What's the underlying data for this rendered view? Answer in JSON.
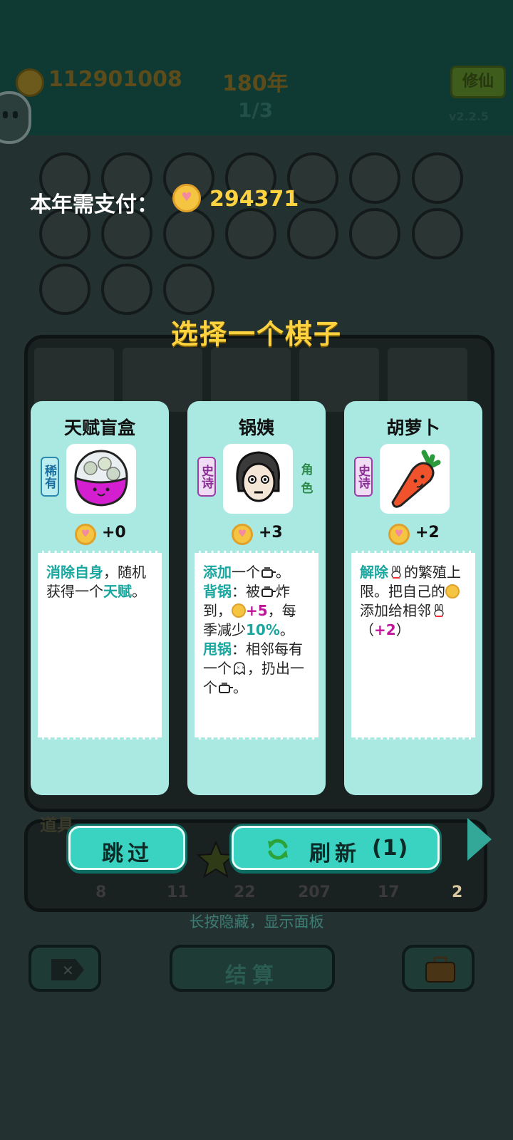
{
  "status_bar": {
    "gold": "112901008",
    "year": "180年",
    "round": "1/3",
    "version": "v2.2.5",
    "xiuxian_label": "修仙"
  },
  "overlay": {
    "pay_label": "本年需支付：",
    "pay_amount": "294371",
    "choose_title": "选择一个棋子"
  },
  "cards": [
    {
      "title": "天赋盲盒",
      "rarity": "稀有",
      "side_tag": "",
      "portrait_icon": "gacha-capsule-icon",
      "price": "+0",
      "desc": {
        "kw1": "消除自身",
        "t1": "，随机获得一个",
        "kw2": "天赋",
        "t2": "。"
      }
    },
    {
      "title": "锅姨",
      "rarity": "史诗",
      "side_tag": "角色",
      "portrait_icon": "auntie-face-icon",
      "price": "+3",
      "desc": {
        "kw1": "添加",
        "t1": "一个",
        "t2": "。",
        "kw2": "背锅",
        "t3": "：被",
        "t4": "炸到，",
        "plus": "+5",
        "t5": "，每季减少",
        "pct": "10%",
        "t6": "。",
        "kw3": "甩锅",
        "t7": "：相邻每有一个",
        "t8": "，扔出一个",
        "t9": "。"
      }
    },
    {
      "title": "胡萝卜",
      "rarity": "史诗",
      "side_tag": "",
      "portrait_icon": "carrot-icon",
      "price": "+2",
      "desc": {
        "kw1": "解除",
        "t1": "的繁殖上限。把自己的",
        "t2": "添加给相邻",
        "t3": "（",
        "plus": "+2",
        "t4": "）"
      }
    }
  ],
  "tools": {
    "label": "道具",
    "counts": [
      "8",
      "11",
      "22",
      "207",
      "17",
      "2"
    ]
  },
  "actions": {
    "skip_label": "跳过",
    "refresh_label": "刷新",
    "refresh_count": "(1)"
  },
  "hint": "长按隐藏，显示面板",
  "bottom": {
    "settle_label": "结算"
  },
  "colors": {
    "accent": "#3ad3c2",
    "gold_text": "#ffd23f",
    "card_bg": "#a9e9e1",
    "keyword": "#1aa7a0"
  }
}
